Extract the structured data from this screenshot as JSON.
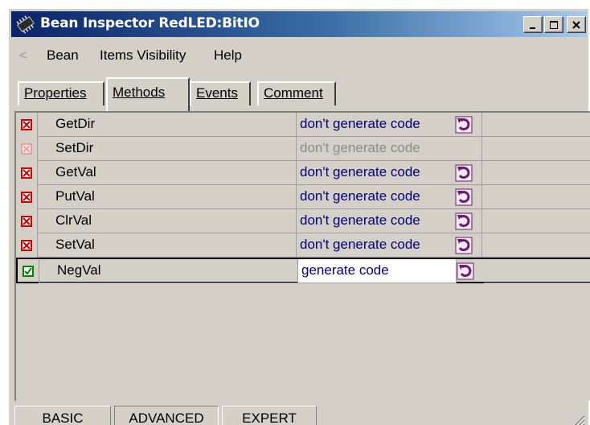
{
  "window": {
    "title": "Bean Inspector RedLED:BitIO",
    "controls": [
      "minimize",
      "maximize",
      "close"
    ]
  },
  "menubar": {
    "back_glyph": "<",
    "items": [
      "Bean",
      "Items Visibility",
      "Help"
    ]
  },
  "tabs": [
    {
      "label": "Properties",
      "active": false
    },
    {
      "label": "Methods",
      "active": true
    },
    {
      "label": "Events",
      "active": false
    },
    {
      "label": "Comment",
      "active": false
    }
  ],
  "methods": [
    {
      "name": "GetDir",
      "value": "don't generate code",
      "checked": false,
      "enabled": true
    },
    {
      "name": "SetDir",
      "value": "don't generate code",
      "checked": false,
      "enabled": false
    },
    {
      "name": "GetVal",
      "value": "don't generate code",
      "checked": false,
      "enabled": true
    },
    {
      "name": "PutVal",
      "value": "don't generate code",
      "checked": false,
      "enabled": true
    },
    {
      "name": "ClrVal",
      "value": "don't generate code",
      "checked": false,
      "enabled": true
    },
    {
      "name": "SetVal",
      "value": "don't generate code",
      "checked": false,
      "enabled": true
    },
    {
      "name": "NegVal",
      "value": "generate code",
      "checked": true,
      "enabled": true,
      "selected": true
    }
  ],
  "modes": [
    {
      "label": "BASIC",
      "pressed": false
    },
    {
      "label": "ADVANCED",
      "pressed": true
    },
    {
      "label": "EXPERT",
      "pressed": false
    }
  ],
  "colors": {
    "titlebar_start": "#0a246a",
    "titlebar_end": "#a6caf0",
    "value_text": "#00007a",
    "disabled_text": "#8c8c8c",
    "checkbox_off": "#cc0000",
    "checkbox_on": "#008000",
    "reset_icon": "#6a1b6a"
  }
}
